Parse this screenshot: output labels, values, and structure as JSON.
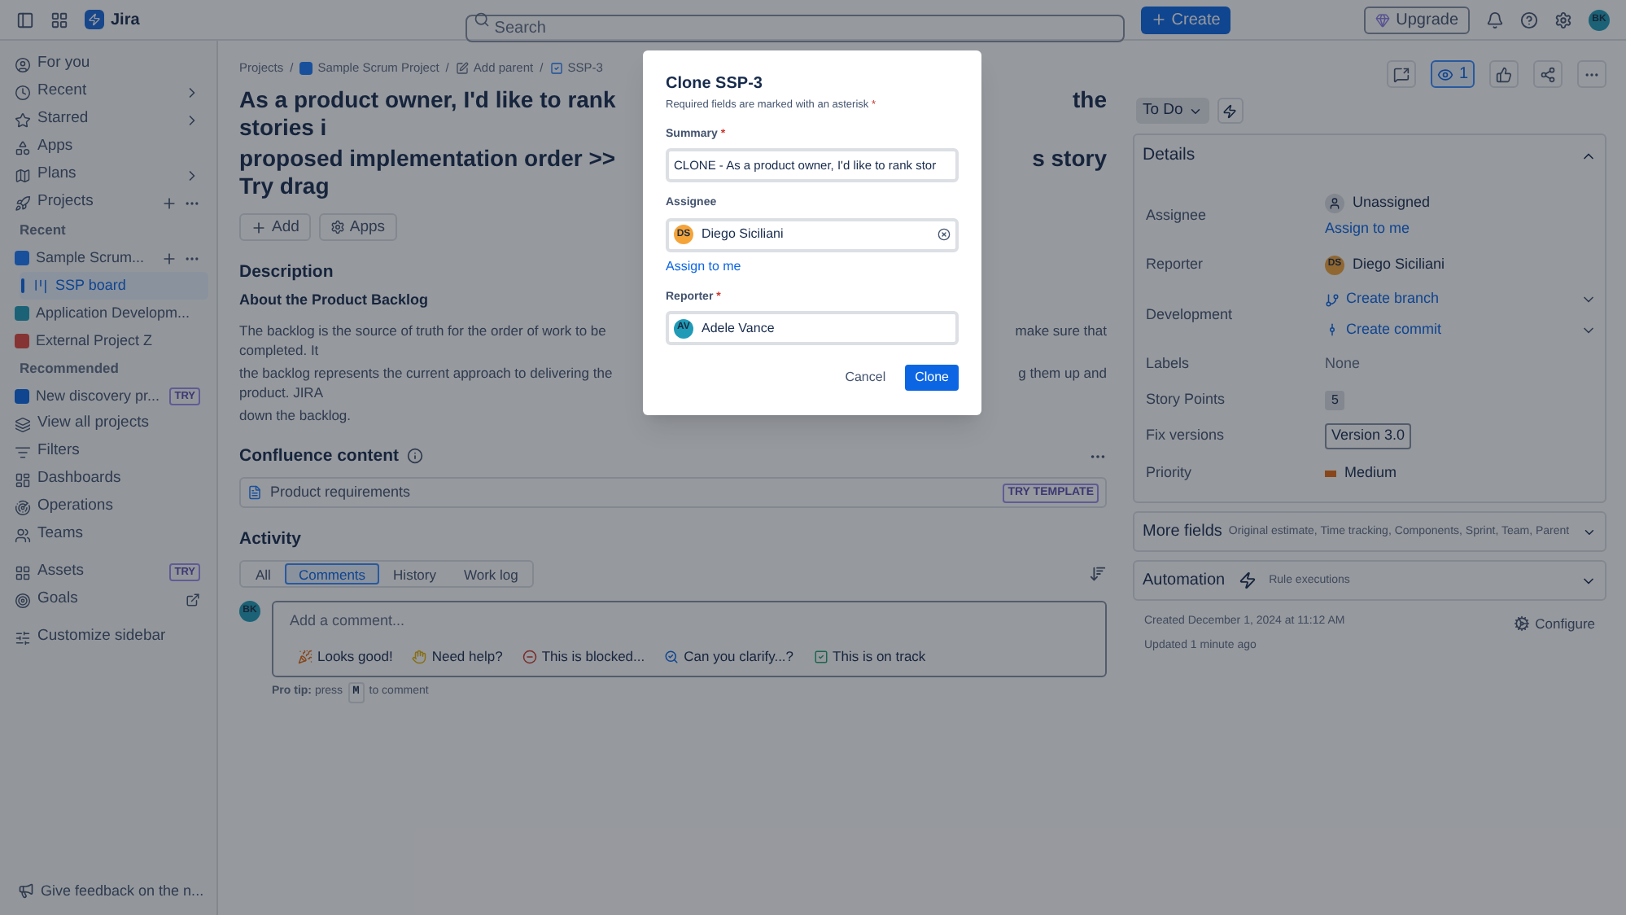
{
  "topbar": {
    "product": "Jira",
    "search_placeholder": "Search",
    "create": "Create",
    "upgrade": "Upgrade",
    "avatar": "BK"
  },
  "sidebar": {
    "items": [
      {
        "kind": "nav",
        "label": "For you",
        "selected": false
      },
      {
        "kind": "nav",
        "label": "Recent",
        "selected": false
      },
      {
        "kind": "nav",
        "label": "Starred",
        "selected": false
      },
      {
        "kind": "nav",
        "label": "Apps",
        "selected": false
      },
      {
        "kind": "nav",
        "label": "Plans",
        "selected": false
      },
      {
        "kind": "nav",
        "label": "Projects",
        "selected": false
      },
      {
        "kind": "heading",
        "label": "Recent"
      },
      {
        "kind": "project",
        "label": "Sample Scrum...",
        "selected": false
      },
      {
        "kind": "board",
        "label": "SSP board",
        "selected": true
      },
      {
        "kind": "project",
        "label": "Application Developm...",
        "selected": false
      },
      {
        "kind": "project",
        "label": "External Project Z",
        "selected": false
      },
      {
        "kind": "heading",
        "label": "Recommended"
      },
      {
        "kind": "project",
        "label": "New discovery pr...",
        "selected": false,
        "badge": "TRY"
      },
      {
        "kind": "nav",
        "label": "View all projects",
        "selected": false
      },
      {
        "kind": "nav",
        "label": "Filters",
        "selected": false
      },
      {
        "kind": "nav",
        "label": "Dashboards",
        "selected": false
      },
      {
        "kind": "nav",
        "label": "Operations",
        "selected": false
      },
      {
        "kind": "nav",
        "label": "Teams",
        "selected": false
      },
      {
        "kind": "nav",
        "label": "Assets",
        "selected": false,
        "badge": "TRY"
      },
      {
        "kind": "nav",
        "label": "Goals",
        "selected": false
      },
      {
        "kind": "nav",
        "label": "Customize sidebar",
        "selected": false
      }
    ],
    "feedback": "Give feedback on the n..."
  },
  "issue": {
    "breadcrumbs": [
      {
        "label": "Projects",
        "separator": "/"
      },
      {
        "label": "Sample Scrum Project",
        "separator": "/"
      },
      {
        "label": "Add parent",
        "separator": "/"
      },
      {
        "label": "SSP-3"
      }
    ],
    "title_lines": [
      {
        "left": "As a product owner, I'd like to rank stories i",
        "right": "the"
      },
      {
        "left": "proposed implementation order >> Try drag",
        "right": "s story"
      }
    ],
    "actions": [
      "Add",
      "Apps"
    ],
    "description": {
      "title": "Description",
      "subtitle": "About the Product Backlog",
      "lines": [
        {
          "left": "The backlog is the source of truth for the order of work to be completed. It",
          "right": "make sure that"
        },
        {
          "left": "the backlog represents the current approach to delivering the product. JIRA",
          "right": "g them up and"
        },
        {
          "left": "down the backlog."
        }
      ]
    },
    "confluence": {
      "title": "Confluence content",
      "item": "Product requirements",
      "badge": "TRY TEMPLATE"
    },
    "activity": {
      "title": "Activity",
      "tabs": [
        {
          "label": "All",
          "selected": false
        },
        {
          "label": "Comments",
          "selected": true
        },
        {
          "label": "History",
          "selected": false
        },
        {
          "label": "Work log",
          "selected": false
        }
      ],
      "avatar": "BK",
      "placeholder": "Add a comment...",
      "quick_replies": [
        "Looks good!",
        "Need help?",
        "This is blocked...",
        "Can you clarify...?",
        "This is on track"
      ],
      "tip": "**Pro tip:** press",
      "tip_key": "M",
      "tip_end": "to comment"
    }
  },
  "panel": {
    "watchers": "1",
    "status": "To Do",
    "details": {
      "title": "Details",
      "fields": [
        {
          "kind": "unassigned",
          "label": "Assignee",
          "value": "Unassigned",
          "link": "Assign to me"
        },
        {
          "kind": "person",
          "label": "Reporter",
          "avatar": "DS",
          "value": "Diego Siciliani"
        },
        {
          "kind": "dev",
          "label": "Development",
          "links": [
            "Create branch",
            "Create commit"
          ]
        },
        {
          "kind": "text",
          "label": "Labels",
          "value": "None"
        },
        {
          "kind": "badge",
          "label": "Story Points",
          "value": "5"
        },
        {
          "kind": "tag",
          "label": "Fix versions",
          "value": "Version 3.0"
        },
        {
          "kind": "priority",
          "label": "Priority",
          "value": "Medium"
        }
      ]
    },
    "more_fields": {
      "title": "More fields",
      "subtitle": "Original estimate, Time tracking, Components, Sprint, Team, Parent"
    },
    "automation": {
      "title": "Automation",
      "subtitle": "Rule executions"
    },
    "created": "Created December 1, 2024 at 11:12 AM",
    "updated": "Updated 1 minute ago",
    "configure": "Configure"
  },
  "modal": {
    "title": "Clone SSP-3",
    "note": "Required fields are marked with an asterisk",
    "required_mark": "*",
    "fields": [
      {
        "kind": "text",
        "label": "Summary",
        "required": true,
        "value": "CLONE - As a product owner, I'd like to rank stor"
      },
      {
        "kind": "person",
        "label": "Assignee",
        "required": false,
        "avatar": "DS",
        "value": "Diego Siciliani",
        "link": "Assign to me"
      },
      {
        "kind": "person",
        "label": "Reporter",
        "required": true,
        "avatar": "AV",
        "value": "Adele Vance"
      }
    ],
    "cancel": "Cancel",
    "confirm": "Clone"
  }
}
